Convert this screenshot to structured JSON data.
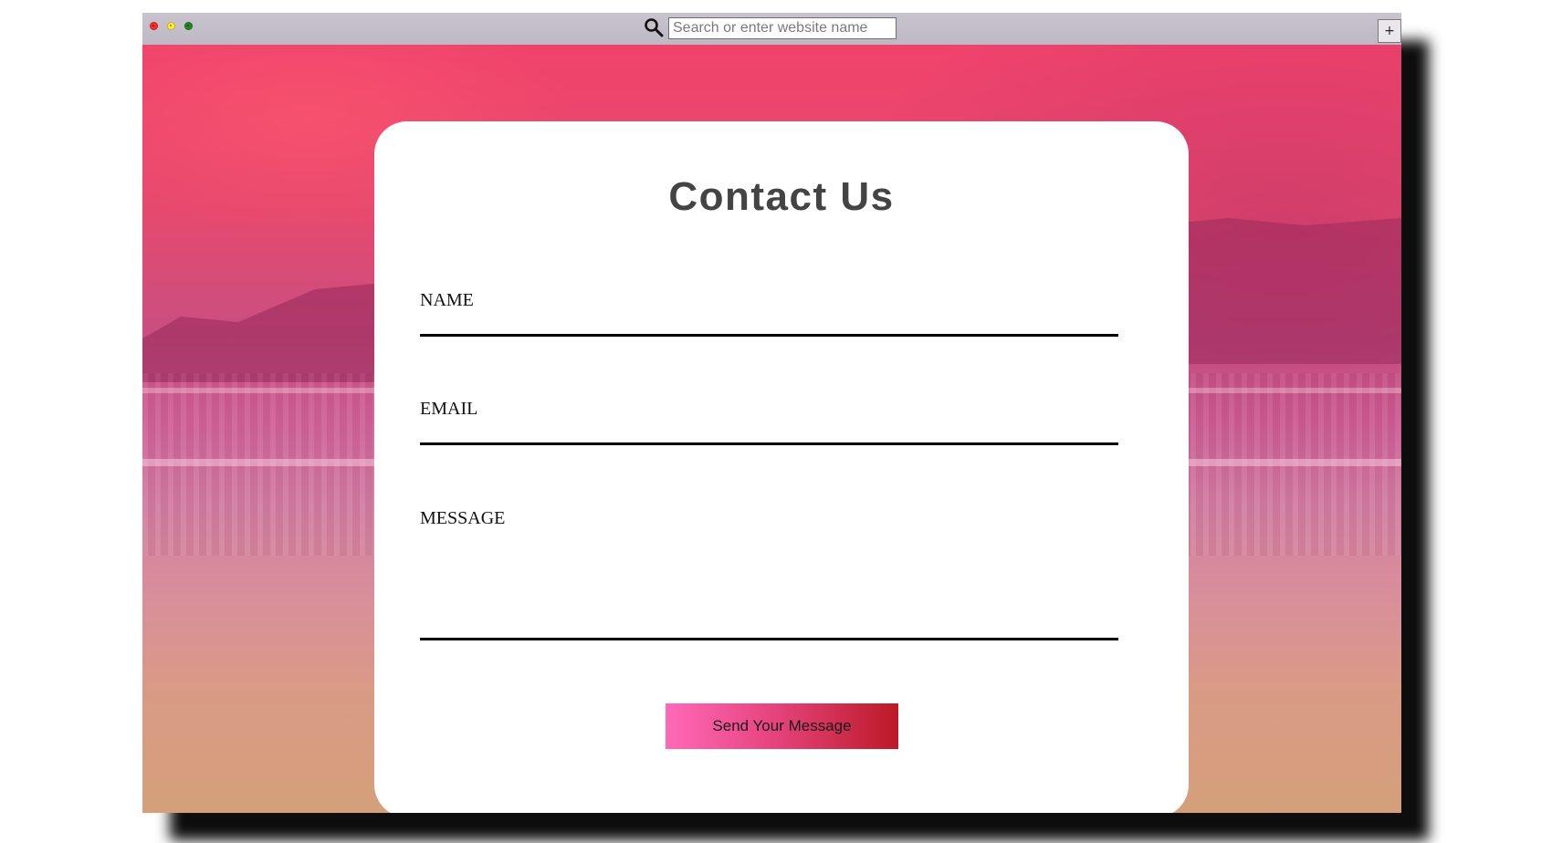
{
  "browser": {
    "search_placeholder": "Search or enter website name",
    "new_tab_label": "+",
    "traffic_light_colors": [
      "#ff2a2a",
      "#ffee33",
      "#1f8a1f"
    ]
  },
  "contact_form": {
    "title": "Contact Us",
    "name_label": "NAME",
    "email_label": "EMAIL",
    "message_label": "MESSAGE",
    "submit_label": "Send Your Message"
  },
  "theme": {
    "button_gradient": [
      "#ff69b9",
      "#bb1a27"
    ],
    "title_color": "#444444"
  }
}
